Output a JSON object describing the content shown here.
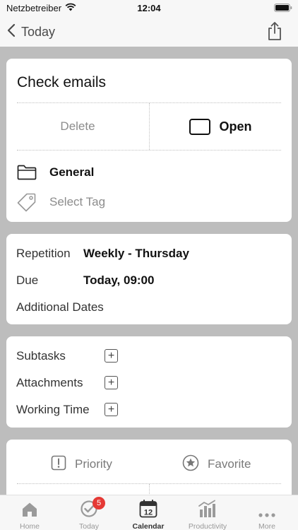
{
  "status_bar": {
    "carrier": "Netzbetreiber",
    "time": "12:04"
  },
  "nav": {
    "back_label": "Today"
  },
  "task": {
    "title": "Check emails",
    "delete_label": "Delete",
    "status_label": "Open",
    "category": "General",
    "tag_placeholder": "Select Tag"
  },
  "schedule": {
    "repetition_label": "Repetition",
    "repetition_value": "Weekly - Thursday",
    "due_label": "Due",
    "due_value": "Today, 09:00",
    "additional_dates_label": "Additional Dates"
  },
  "extras": {
    "subtasks_label": "Subtasks",
    "attachments_label": "Attachments",
    "working_time_label": "Working Time"
  },
  "flags": {
    "priority_label": "Priority",
    "favorite_label": "Favorite"
  },
  "tabbar": {
    "items": [
      {
        "label": "Home",
        "icon": "home-icon"
      },
      {
        "label": "Today",
        "icon": "today-icon",
        "badge": "5"
      },
      {
        "label": "Calendar",
        "icon": "calendar-icon",
        "day": "12"
      },
      {
        "label": "Productivity",
        "icon": "productivity-icon"
      },
      {
        "label": "More",
        "icon": "more-icon"
      }
    ]
  }
}
